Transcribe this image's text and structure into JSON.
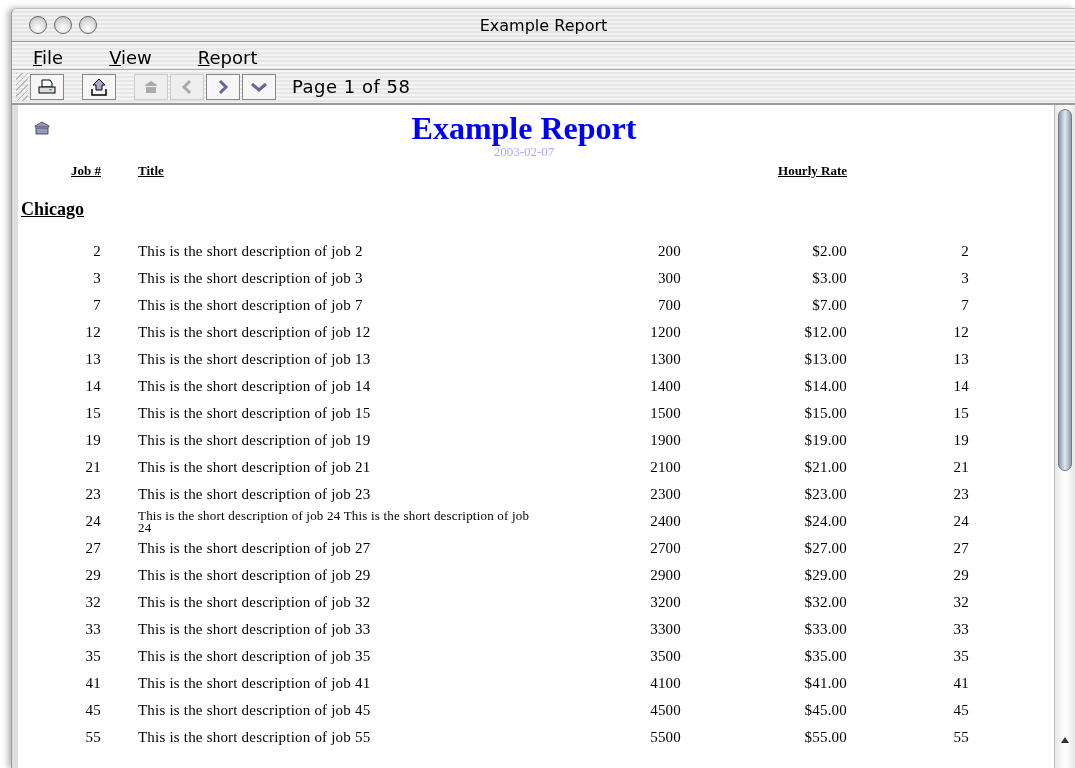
{
  "window": {
    "title": "Example Report"
  },
  "menu": [
    "File",
    "View",
    "Report"
  ],
  "toolbar": {
    "buttons": [
      {
        "kind": "print",
        "disabled": false
      },
      {
        "kind": "export",
        "disabled": false
      },
      {
        "kind": "home",
        "disabled": true
      },
      {
        "kind": "previous",
        "disabled": true
      },
      {
        "kind": "next",
        "disabled": false
      },
      {
        "kind": "last",
        "disabled": false
      }
    ],
    "page_label": "Page 1 of 58"
  },
  "report": {
    "title": "Example Report",
    "date": "2003-02-07",
    "columns": [
      {
        "label": "Job #"
      },
      {
        "label": "Title"
      },
      {},
      {
        "label": "Hourly Rate"
      },
      {}
    ],
    "group": "Chicago",
    "rows": [
      [
        "2",
        "This is the short description of job 2",
        "200",
        "$2.00",
        "2"
      ],
      [
        "3",
        "This is the short description of job 3",
        "300",
        "$3.00",
        "3"
      ],
      [
        "7",
        "This is the short description of job 7",
        "700",
        "$7.00",
        "7"
      ],
      [
        "12",
        "This is the short description of job 12",
        "1200",
        "$12.00",
        "12"
      ],
      [
        "13",
        "This is the short description of job 13",
        "1300",
        "$13.00",
        "13"
      ],
      [
        "14",
        "This is the short description of job 14",
        "1400",
        "$14.00",
        "14"
      ],
      [
        "15",
        "This is the short description of job 15",
        "1500",
        "$15.00",
        "15"
      ],
      [
        "19",
        "This is the short description of job 19",
        "1900",
        "$19.00",
        "19"
      ],
      [
        "21",
        "This is the short description of job 21",
        "2100",
        "$21.00",
        "21"
      ],
      [
        "23",
        "This is the short description of job 23",
        "2300",
        "$23.00",
        "23"
      ],
      [
        "24",
        "This is the short description of job 24 This is the short description of job 24",
        "2400",
        "$24.00",
        "24"
      ],
      [
        "27",
        "This is the short description of job 27",
        "2700",
        "$27.00",
        "27"
      ],
      [
        "29",
        "This is the short description of job 29",
        "2900",
        "$29.00",
        "29"
      ],
      [
        "32",
        "This is the short description of job 32",
        "3200",
        "$32.00",
        "32"
      ],
      [
        "33",
        "This is the short description of job 33",
        "3300",
        "$33.00",
        "33"
      ],
      [
        "35",
        "This is the short description of job 35",
        "3500",
        "$35.00",
        "35"
      ],
      [
        "41",
        "This is the short description of job 41",
        "4100",
        "$41.00",
        "41"
      ],
      [
        "45",
        "This is the short description of job 45",
        "4500",
        "$45.00",
        "45"
      ],
      [
        "55",
        "This is the short description of job 55",
        "5500",
        "$55.00",
        "55"
      ]
    ]
  }
}
